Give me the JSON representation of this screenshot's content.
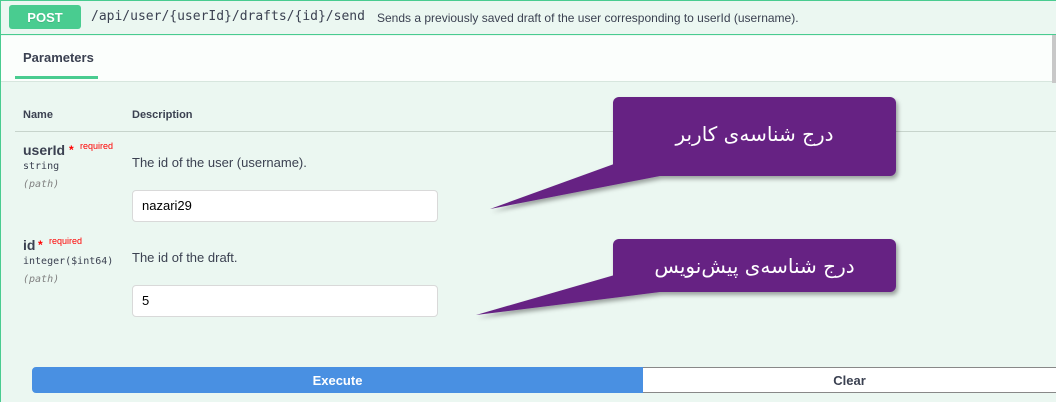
{
  "operation": {
    "method": "POST",
    "path": "/api/user/{userId}/drafts/{id}/send",
    "summary": "Sends a previously saved draft of the user corresponding to userId (username)."
  },
  "tabs": {
    "parameters_label": "Parameters"
  },
  "table": {
    "col_name": "Name",
    "col_description": "Description"
  },
  "params": [
    {
      "name": "userId",
      "required_star": "*",
      "required_label": "required",
      "type": "string",
      "in": "(path)",
      "description": "The id of the user (username).",
      "value": "nazari29"
    },
    {
      "name": "id",
      "required_star": "*",
      "required_label": "required",
      "type": "integer($int64)",
      "in": "(path)",
      "description": "The id of the draft.",
      "value": "5"
    }
  ],
  "buttons": {
    "execute": "Execute",
    "clear": "Clear"
  },
  "callouts": [
    {
      "text": "درج شناسه‌ی کاربر"
    },
    {
      "text": "درج شناسه‌ی پیش‌نویس"
    }
  ],
  "colors": {
    "post": "#49cc90",
    "execute": "#4990e2",
    "callout": "#662383",
    "required": "#ff0000"
  }
}
